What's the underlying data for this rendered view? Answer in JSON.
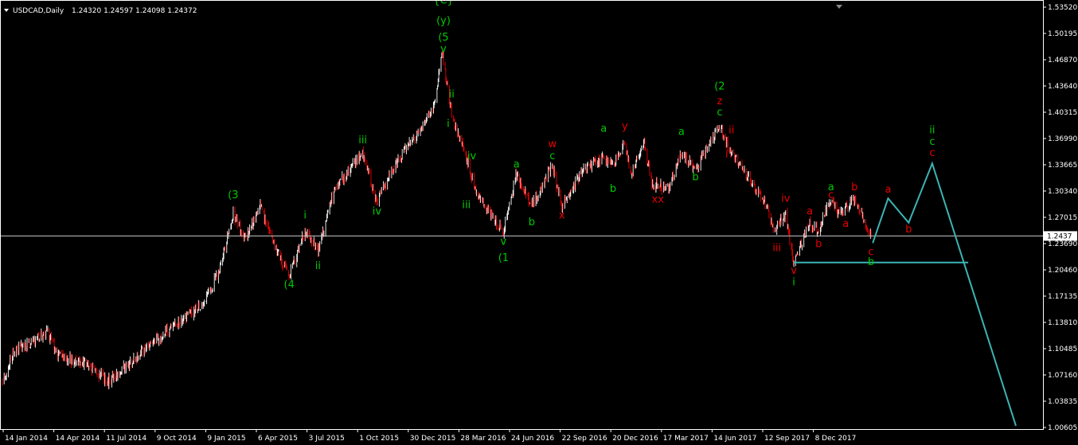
{
  "header": {
    "menu_icon": "triangle-down-icon",
    "symbol": "USDCAD,Daily",
    "ohlc": "1.24320 1.24597 1.24098 1.24372"
  },
  "chart_data": {
    "type": "bar",
    "symbol": "USDCAD",
    "timeframe": "Daily",
    "current_price": 1.24372,
    "current_price_label": "1.2437",
    "ylim": [
      1.006,
      1.5332
    ],
    "y_ticks": [
      "1.53520",
      "1.50195",
      "1.46870",
      "1.43640",
      "1.40315",
      "1.36990",
      "1.33665",
      "1.30340",
      "1.27015",
      "1.23690",
      "1.20460",
      "1.17135",
      "1.13810",
      "1.10485",
      "1.07160",
      "1.03835",
      "1.00605"
    ],
    "x_ticks": [
      "14 Jan 2014",
      "14 Apr 2014",
      "11 Jul 2014",
      "9 Oct 2014",
      "9 Jan 2015",
      "6 Apr 2015",
      "3 Jul 2015",
      "1 Oct 2015",
      "30 Dec 2015",
      "28 Mar 2016",
      "24 Jun 2016",
      "22 Sep 2016",
      "20 Dec 2016",
      "17 Mar 2017",
      "14 Jun 2017",
      "12 Sep 2017",
      "8 Dec 2017"
    ],
    "price_path": [
      [
        "2014-01-03",
        1.065
      ],
      [
        "2014-01-21",
        1.1
      ],
      [
        "2014-03-20",
        1.125
      ],
      [
        "2014-04-10",
        1.095
      ],
      [
        "2014-05-25",
        1.085
      ],
      [
        "2014-07-03",
        1.065
      ],
      [
        "2014-08-20",
        1.095
      ],
      [
        "2014-10-15",
        1.13
      ],
      [
        "2014-12-10",
        1.16
      ],
      [
        "2015-01-05",
        1.2
      ],
      [
        "2015-01-30",
        1.27
      ],
      [
        "2015-02-20",
        1.24
      ],
      [
        "2015-03-17",
        1.28
      ],
      [
        "2015-04-20",
        1.215
      ],
      [
        "2015-05-05",
        1.195
      ],
      [
        "2015-06-01",
        1.25
      ],
      [
        "2015-06-23",
        1.225
      ],
      [
        "2015-07-20",
        1.3
      ],
      [
        "2015-08-24",
        1.335
      ],
      [
        "2015-09-07",
        1.345
      ],
      [
        "2015-10-01",
        1.285
      ],
      [
        "2015-11-01",
        1.33
      ],
      [
        "2016-01-05",
        1.4
      ],
      [
        "2016-01-20",
        1.469
      ],
      [
        "2016-02-05",
        1.395
      ],
      [
        "2016-03-01",
        1.34
      ],
      [
        "2016-03-20",
        1.29
      ],
      [
        "2016-05-03",
        1.25
      ],
      [
        "2016-05-25",
        1.32
      ],
      [
        "2016-06-20",
        1.28
      ],
      [
        "2016-07-25",
        1.33
      ],
      [
        "2016-08-10",
        1.28
      ],
      [
        "2016-09-15",
        1.325
      ],
      [
        "2016-10-20",
        1.34
      ],
      [
        "2016-11-05",
        1.33
      ],
      [
        "2016-11-25",
        1.358
      ],
      [
        "2016-12-05",
        1.32
      ],
      [
        "2016-12-28",
        1.355
      ],
      [
        "2017-01-10",
        1.31
      ],
      [
        "2017-02-05",
        1.3
      ],
      [
        "2017-03-01",
        1.345
      ],
      [
        "2017-03-25",
        1.325
      ],
      [
        "2017-05-05",
        1.38
      ],
      [
        "2017-05-25",
        1.345
      ],
      [
        "2017-06-10",
        1.33
      ],
      [
        "2017-07-25",
        1.28
      ],
      [
        "2017-08-05",
        1.25
      ],
      [
        "2017-08-25",
        1.27
      ],
      [
        "2017-09-08",
        1.21
      ],
      [
        "2017-10-05",
        1.26
      ],
      [
        "2017-10-20",
        1.25
      ],
      [
        "2017-11-10",
        1.29
      ],
      [
        "2017-11-25",
        1.27
      ],
      [
        "2017-12-05",
        1.28
      ],
      [
        "2017-12-20",
        1.29
      ],
      [
        "2018-01-17",
        1.2437
      ]
    ],
    "series": [
      {
        "type": "horizontal_line",
        "color": "#c8c8c8",
        "y": 1.24372
      },
      {
        "type": "projection",
        "color": "#3cb4b4",
        "points": [
          [
            "2018-01-20",
            1.235
          ],
          [
            "2018-02-15",
            1.29
          ],
          [
            "2018-03-22",
            1.26
          ],
          [
            "2018-05-01",
            1.333
          ],
          [
            "2018-09-20",
            1.01
          ]
        ]
      },
      {
        "type": "support_line",
        "color": "#3cb4b4",
        "points": [
          [
            "2017-09-08",
            1.211
          ],
          [
            "2018-07-01",
            1.211
          ]
        ]
      }
    ],
    "annotations": [
      {
        "text": "{C}",
        "color": "#00c800",
        "x": "2016-01-22",
        "y": 1.53
      },
      {
        "text": "(y)",
        "color": "#00c800",
        "x": "2016-01-22",
        "y": 1.505
      },
      {
        "text": "(5",
        "color": "#00c800",
        "x": "2016-01-22",
        "y": 1.484
      },
      {
        "text": "v",
        "color": "#00c800",
        "x": "2016-01-22",
        "y": 1.47
      },
      {
        "text": "(3",
        "color": "#00c800",
        "x": "2015-01-30",
        "y": 1.29
      },
      {
        "text": "(4",
        "color": "#00c800",
        "x": "2015-05-05",
        "y": 1.18
      },
      {
        "text": "i",
        "color": "#00c800",
        "x": "2015-06-01",
        "y": 1.265
      },
      {
        "text": "ii",
        "color": "#00c800",
        "x": "2015-06-23",
        "y": 1.203
      },
      {
        "text": "iii",
        "color": "#00c800",
        "x": "2015-09-07",
        "y": 1.358
      },
      {
        "text": "iv",
        "color": "#00c800",
        "x": "2015-10-01",
        "y": 1.27
      },
      {
        "text": "ii",
        "color": "#00c800",
        "x": "2016-02-05",
        "y": 1.414
      },
      {
        "text": "i",
        "color": "#00c800",
        "x": "2016-01-30",
        "y": 1.378
      },
      {
        "text": "iv",
        "color": "#00c800",
        "x": "2016-03-10",
        "y": 1.338
      },
      {
        "text": "iii",
        "color": "#00c800",
        "x": "2016-03-01",
        "y": 1.278
      },
      {
        "text": "v",
        "color": "#00c800",
        "x": "2016-05-03",
        "y": 1.233
      },
      {
        "text": "(1",
        "color": "#00c800",
        "x": "2016-05-03",
        "y": 1.213
      },
      {
        "text": "a",
        "color": "#00c800",
        "x": "2016-05-25",
        "y": 1.328
      },
      {
        "text": "b",
        "color": "#00c800",
        "x": "2016-06-20",
        "y": 1.257
      },
      {
        "text": "c",
        "color": "#00c800",
        "x": "2016-07-25",
        "y": 1.338
      },
      {
        "text": "w",
        "color": "#e60000",
        "x": "2016-07-25",
        "y": 1.353
      },
      {
        "text": "x",
        "color": "#e60000",
        "x": "2016-08-10",
        "y": 1.265
      },
      {
        "text": "a",
        "color": "#00c800",
        "x": "2016-10-20",
        "y": 1.372
      },
      {
        "text": "b",
        "color": "#00c800",
        "x": "2016-11-05",
        "y": 1.298
      },
      {
        "text": "y",
        "color": "#e60000",
        "x": "2016-11-25",
        "y": 1.375
      },
      {
        "text": "xx",
        "color": "#e60000",
        "x": "2017-01-20",
        "y": 1.285
      },
      {
        "text": "a",
        "color": "#00c800",
        "x": "2017-03-01",
        "y": 1.368
      },
      {
        "text": "b",
        "color": "#00c800",
        "x": "2017-03-25",
        "y": 1.312
      },
      {
        "text": "(2",
        "color": "#00c800",
        "x": "2017-05-05",
        "y": 1.424
      },
      {
        "text": "z",
        "color": "#e60000",
        "x": "2017-05-05",
        "y": 1.406
      },
      {
        "text": "c",
        "color": "#00c800",
        "x": "2017-05-05",
        "y": 1.392
      },
      {
        "text": "ii",
        "color": "#e60000",
        "x": "2017-05-25",
        "y": 1.37
      },
      {
        "text": "i",
        "color": "#e60000",
        "x": "2017-05-17",
        "y": 1.34
      },
      {
        "text": "iv",
        "color": "#e60000",
        "x": "2017-08-25",
        "y": 1.286
      },
      {
        "text": "iii",
        "color": "#e60000",
        "x": "2017-08-10",
        "y": 1.225
      },
      {
        "text": "v",
        "color": "#e60000",
        "x": "2017-09-08",
        "y": 1.197
      },
      {
        "text": "i",
        "color": "#00c800",
        "x": "2017-09-08",
        "y": 1.183
      },
      {
        "text": "a",
        "color": "#e60000",
        "x": "2017-10-05",
        "y": 1.27
      },
      {
        "text": "b",
        "color": "#e60000",
        "x": "2017-10-20",
        "y": 1.23
      },
      {
        "text": "a",
        "color": "#00c800",
        "x": "2017-11-10",
        "y": 1.3
      },
      {
        "text": "c",
        "color": "#e60000",
        "x": "2017-11-10",
        "y": 1.29
      },
      {
        "text": "a",
        "color": "#e60000",
        "x": "2017-12-05",
        "y": 1.255
      },
      {
        "text": "b",
        "color": "#e60000",
        "x": "2017-12-20",
        "y": 1.3
      },
      {
        "text": "c",
        "color": "#e60000",
        "x": "2018-01-17",
        "y": 1.22
      },
      {
        "text": "b",
        "color": "#00c800",
        "x": "2018-01-17",
        "y": 1.208
      },
      {
        "text": "a",
        "color": "#e60000",
        "x": "2018-02-15",
        "y": 1.297
      },
      {
        "text": "b",
        "color": "#e60000",
        "x": "2018-03-22",
        "y": 1.248
      },
      {
        "text": "ii",
        "color": "#00c800",
        "x": "2018-05-01",
        "y": 1.37
      },
      {
        "text": "c",
        "color": "#00c800",
        "x": "2018-05-01",
        "y": 1.356
      },
      {
        "text": "c",
        "color": "#e60000",
        "x": "2018-05-01",
        "y": 1.342
      }
    ],
    "colors": {
      "background": "#000000",
      "candles": "#ffffff",
      "down_candles": "#e60000",
      "axis": "#ffffff",
      "price_line": "#c8c8c8",
      "projection": "#3cb4b4"
    }
  }
}
